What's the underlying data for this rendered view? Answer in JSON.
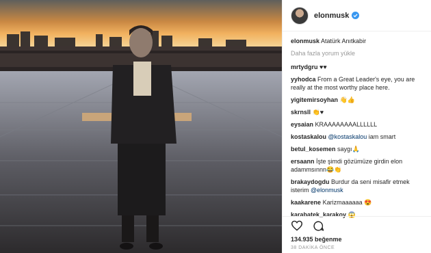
{
  "header": {
    "username": "elonmusk"
  },
  "caption": {
    "username": "elonmusk",
    "text": "Atatürk Anıtkabir"
  },
  "load_more": "Daha fazla yorum yükle",
  "comments": [
    {
      "user": "mrtydgru",
      "text": "♥♥"
    },
    {
      "user": "yyhodca",
      "text": "From a Great Leader's eye, you are really at the most worthy place here."
    },
    {
      "user": "yigitemirsoyhan",
      "text": "👋👍"
    },
    {
      "user": "skrnsll",
      "text": "👏♥"
    },
    {
      "user": "eysaian",
      "text": "KRAAAAAAAALLLLLL"
    },
    {
      "user": "kostaskalou",
      "mention": "@kostaskalou",
      "text": " iam smart"
    },
    {
      "user": "betul_kosemen",
      "text": "saygı🙏"
    },
    {
      "user": "ersaann",
      "text": "İşte şimdi gözümüze girdin elon adammsınnn😂👏"
    },
    {
      "user": "brakaydogdu",
      "text": "Burdur da seni misafir etmek isterim ",
      "mention": "@elonmusk"
    },
    {
      "user": "kaakarene",
      "text": "Karizmaaaaaa 😍"
    },
    {
      "user": "karabatek_karakoy",
      "text": "😱"
    }
  ],
  "likes": "134.935 beğenme",
  "time_ago": "38 DAKİKA ÖNCE",
  "colors": {
    "accent": "#3897f0",
    "mention": "#003569"
  }
}
